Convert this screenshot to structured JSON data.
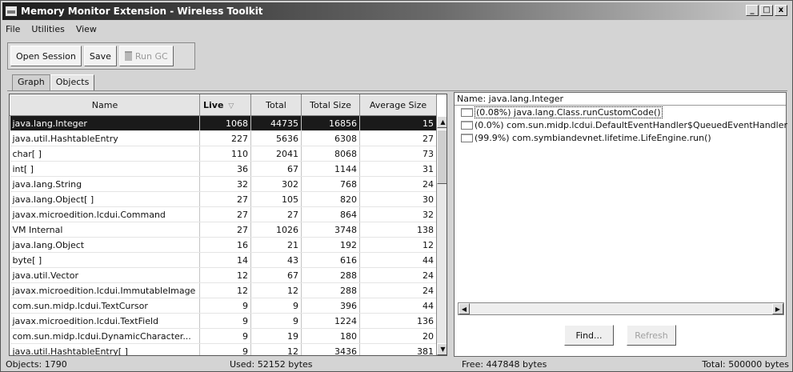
{
  "window": {
    "title": "Memory Monitor Extension - Wireless Toolkit"
  },
  "menu": [
    "File",
    "Utilities",
    "View"
  ],
  "toolbar": {
    "open_label": "Open Session",
    "save_label": "Save",
    "rungc_label": "Run GC"
  },
  "tabs": [
    {
      "label": "Graph",
      "active": false
    },
    {
      "label": "Objects",
      "active": true
    }
  ],
  "table": {
    "columns": [
      "Name",
      "Live",
      "Total",
      "Total Size",
      "Average Size"
    ],
    "sort_indicator": "▽",
    "rows": [
      {
        "name": "java.lang.Integer",
        "live": "1068",
        "total": "44735",
        "total_size": "16856",
        "avg": "15",
        "selected": true
      },
      {
        "name": "java.util.HashtableEntry",
        "live": "227",
        "total": "5636",
        "total_size": "6308",
        "avg": "27"
      },
      {
        "name": "char[ ]",
        "live": "110",
        "total": "2041",
        "total_size": "8068",
        "avg": "73"
      },
      {
        "name": "int[ ]",
        "live": "36",
        "total": "67",
        "total_size": "1144",
        "avg": "31"
      },
      {
        "name": "java.lang.String",
        "live": "32",
        "total": "302",
        "total_size": "768",
        "avg": "24"
      },
      {
        "name": "java.lang.Object[ ]",
        "live": "27",
        "total": "105",
        "total_size": "820",
        "avg": "30"
      },
      {
        "name": "javax.microedition.lcdui.Command",
        "live": "27",
        "total": "27",
        "total_size": "864",
        "avg": "32"
      },
      {
        "name": "VM Internal",
        "live": "27",
        "total": "1026",
        "total_size": "3748",
        "avg": "138"
      },
      {
        "name": "java.lang.Object",
        "live": "16",
        "total": "21",
        "total_size": "192",
        "avg": "12"
      },
      {
        "name": "byte[ ]",
        "live": "14",
        "total": "43",
        "total_size": "616",
        "avg": "44"
      },
      {
        "name": "java.util.Vector",
        "live": "12",
        "total": "67",
        "total_size": "288",
        "avg": "24"
      },
      {
        "name": "javax.microedition.lcdui.ImmutableImage",
        "live": "12",
        "total": "12",
        "total_size": "288",
        "avg": "24"
      },
      {
        "name": "com.sun.midp.lcdui.TextCursor",
        "live": "9",
        "total": "9",
        "total_size": "396",
        "avg": "44"
      },
      {
        "name": "javax.microedition.lcdui.TextField",
        "live": "9",
        "total": "9",
        "total_size": "1224",
        "avg": "136"
      },
      {
        "name": "com.sun.midp.lcdui.DynamicCharacter...",
        "live": "9",
        "total": "19",
        "total_size": "180",
        "avg": "20"
      },
      {
        "name": "java.util.HashtableEntry[ ]",
        "live": "9",
        "total": "12",
        "total_size": "3436",
        "avg": "381"
      }
    ]
  },
  "details": {
    "header": "Name: java.lang.Integer",
    "items": [
      {
        "text": "(0.08%) java.lang.Class.runCustomCode()",
        "selected": true
      },
      {
        "text": "(0.0%) com.sun.midp.lcdui.DefaultEventHandler$QueuedEventHandler"
      },
      {
        "text": "(99.9%) com.symbiandevnet.lifetime.LifeEngine.run()"
      }
    ],
    "find_label": "Find...",
    "refresh_label": "Refresh"
  },
  "status": {
    "objects": "Objects: 1790",
    "used": "Used: 52152 bytes",
    "free": "Free: 447848 bytes",
    "total": "Total: 500000 bytes"
  }
}
